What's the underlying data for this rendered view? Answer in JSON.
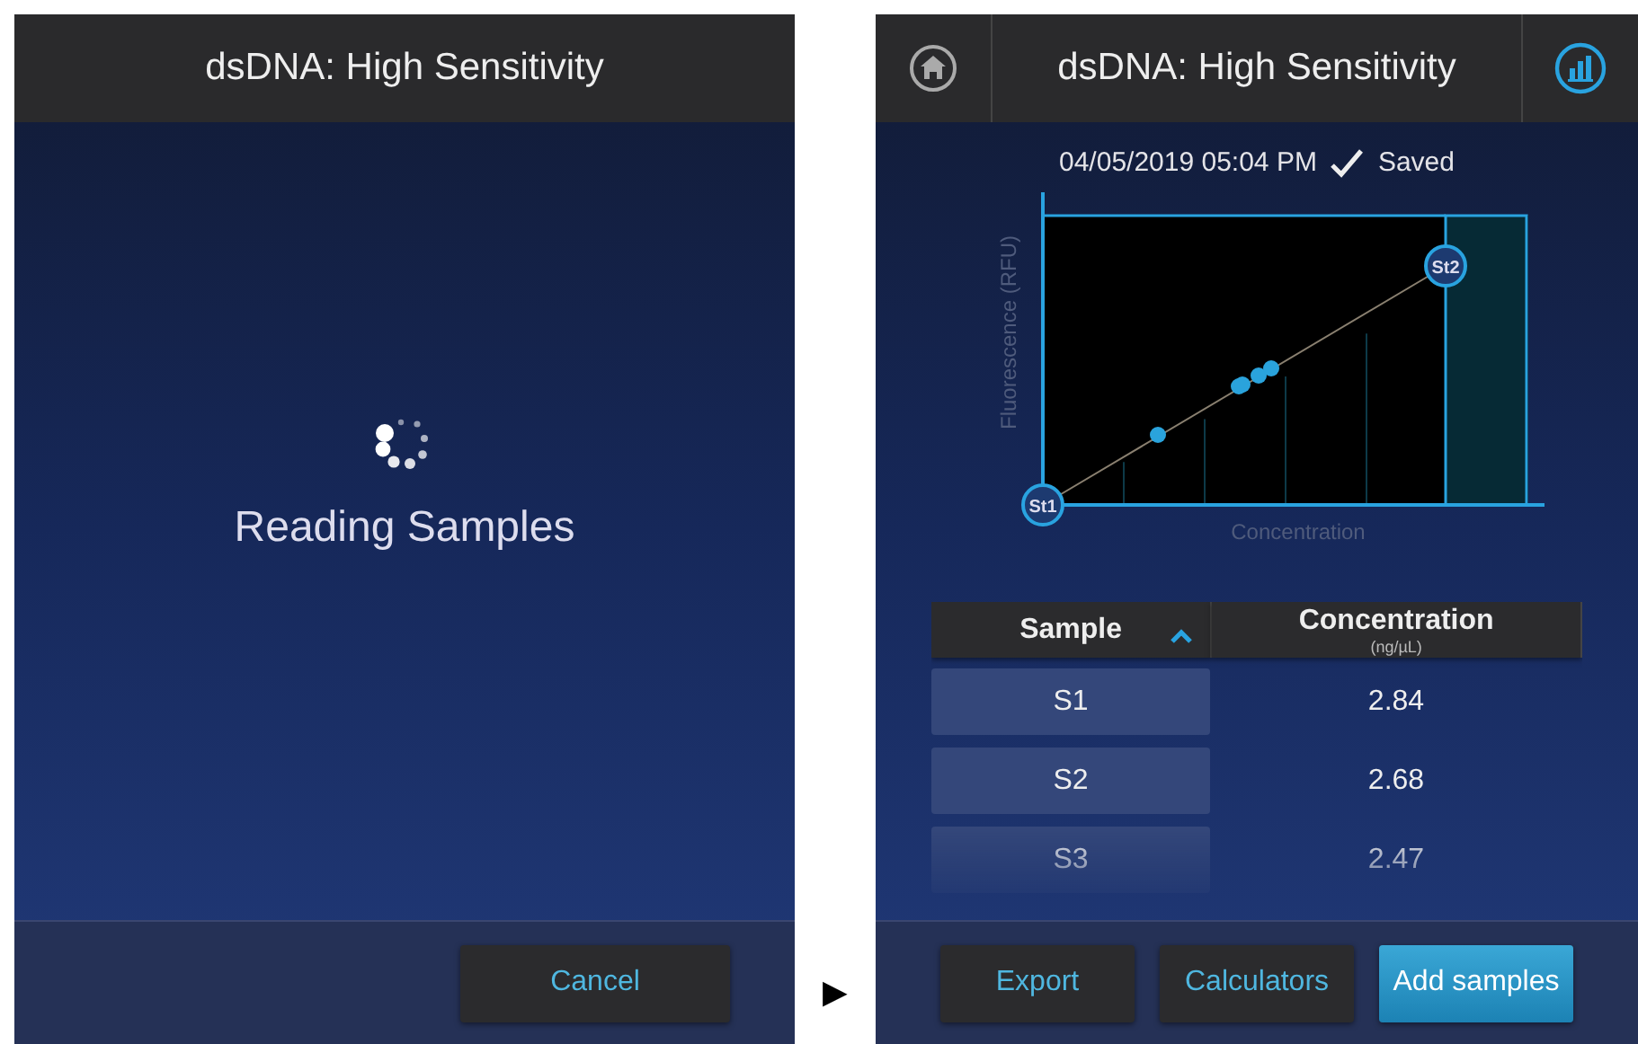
{
  "left_screen": {
    "title": "dsDNA: High Sensitivity",
    "status_text": "Reading Samples",
    "buttons": [
      {
        "label": "Cancel",
        "primary": false
      }
    ]
  },
  "arrow": "▶",
  "right_screen": {
    "title": "dsDNA: High Sensitivity",
    "timestamp": "04/05/2019 05:04 PM",
    "saved_label": "Saved",
    "chart": {
      "ylabel": "Fluorescence (RFU)",
      "xlabel": "Concentration",
      "standards": [
        "St1",
        "St2"
      ]
    },
    "table": {
      "columns": [
        {
          "label": "Sample",
          "sorted_ascending": true
        },
        {
          "label": "Concentration",
          "unit": "(ng/µL)"
        }
      ],
      "rows": [
        {
          "sample": "S1",
          "concentration": "2.84"
        },
        {
          "sample": "S2",
          "concentration": "2.68"
        },
        {
          "sample": "S3",
          "concentration": "2.47"
        }
      ]
    },
    "buttons": [
      {
        "label": "Export",
        "primary": false
      },
      {
        "label": "Calculators",
        "primary": false
      },
      {
        "label": "Add samples",
        "primary": true
      }
    ]
  }
}
